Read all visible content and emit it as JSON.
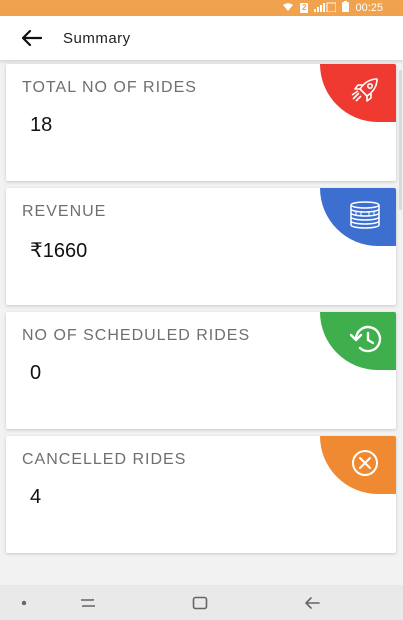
{
  "status_bar": {
    "time": "00:25",
    "sim_badge": "2"
  },
  "app_bar": {
    "title": "Summary"
  },
  "cards": [
    {
      "label": "TOTAL NO OF RIDES",
      "value": "18",
      "badge_color": "#ee3a31",
      "icon": "rocket-icon"
    },
    {
      "label": "REVENUE",
      "value": "₹1660",
      "badge_color": "#3d6fd1",
      "icon": "coins-icon"
    },
    {
      "label": "NO OF SCHEDULED RIDES",
      "value": "0",
      "badge_color": "#3fae4c",
      "icon": "history-icon"
    },
    {
      "label": "CANCELLED RIDES",
      "value": "4",
      "badge_color": "#f08a32",
      "icon": "cancel-icon"
    }
  ],
  "colors": {
    "status_bar": "#f0a24e",
    "app_bar": "#ffffff",
    "background": "#f2f2f2"
  }
}
